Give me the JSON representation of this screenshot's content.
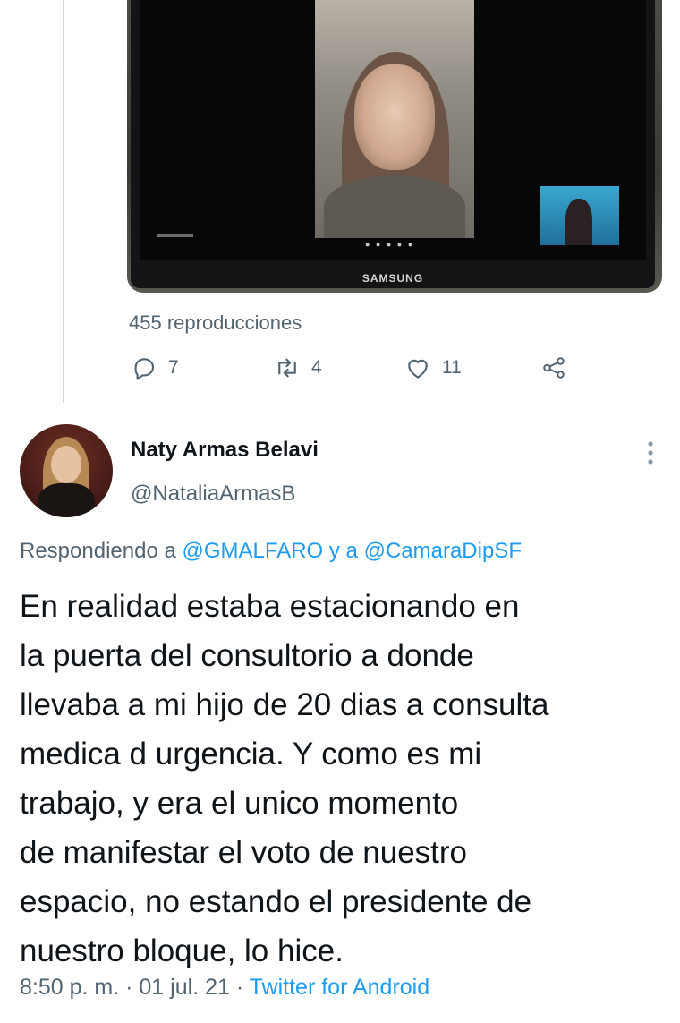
{
  "media": {
    "monitor_brand": "SAMSUNG",
    "views": "455 reproducciones"
  },
  "actions": {
    "reply_count": "7",
    "retweet_count": "4",
    "like_count": "11"
  },
  "tweet": {
    "author_name": "Naty Armas Belavi",
    "author_handle": "@NataliaArmasB",
    "replying_prefix": "Respondiendo a",
    "replying_to_1": "@GMALFARO",
    "replying_join": "y a",
    "replying_to_2": "@CamaraDipSF",
    "text": "En realidad estaba estacionando en\nla puerta del consultorio a donde\nllevaba a mi hijo de 20 dias a consulta\nmedica d urgencia. Y como es mi\ntrabajo, y era el unico momento\nde manifestar el voto de nuestro\nespacio, no estando el presidente de\nnuestro bloque, lo hice.",
    "time": "8:50 p. m.",
    "separator": "·",
    "date": "01 jul. 21",
    "source": "Twitter for Android"
  },
  "icons": {
    "reply": "reply-icon",
    "retweet": "retweet-icon",
    "like": "heart-icon",
    "share": "share-icon",
    "more": "more-vertical-icon"
  },
  "colors": {
    "link": "#1d9bf0",
    "secondary_text": "#536471",
    "primary_text": "#0f1419"
  }
}
